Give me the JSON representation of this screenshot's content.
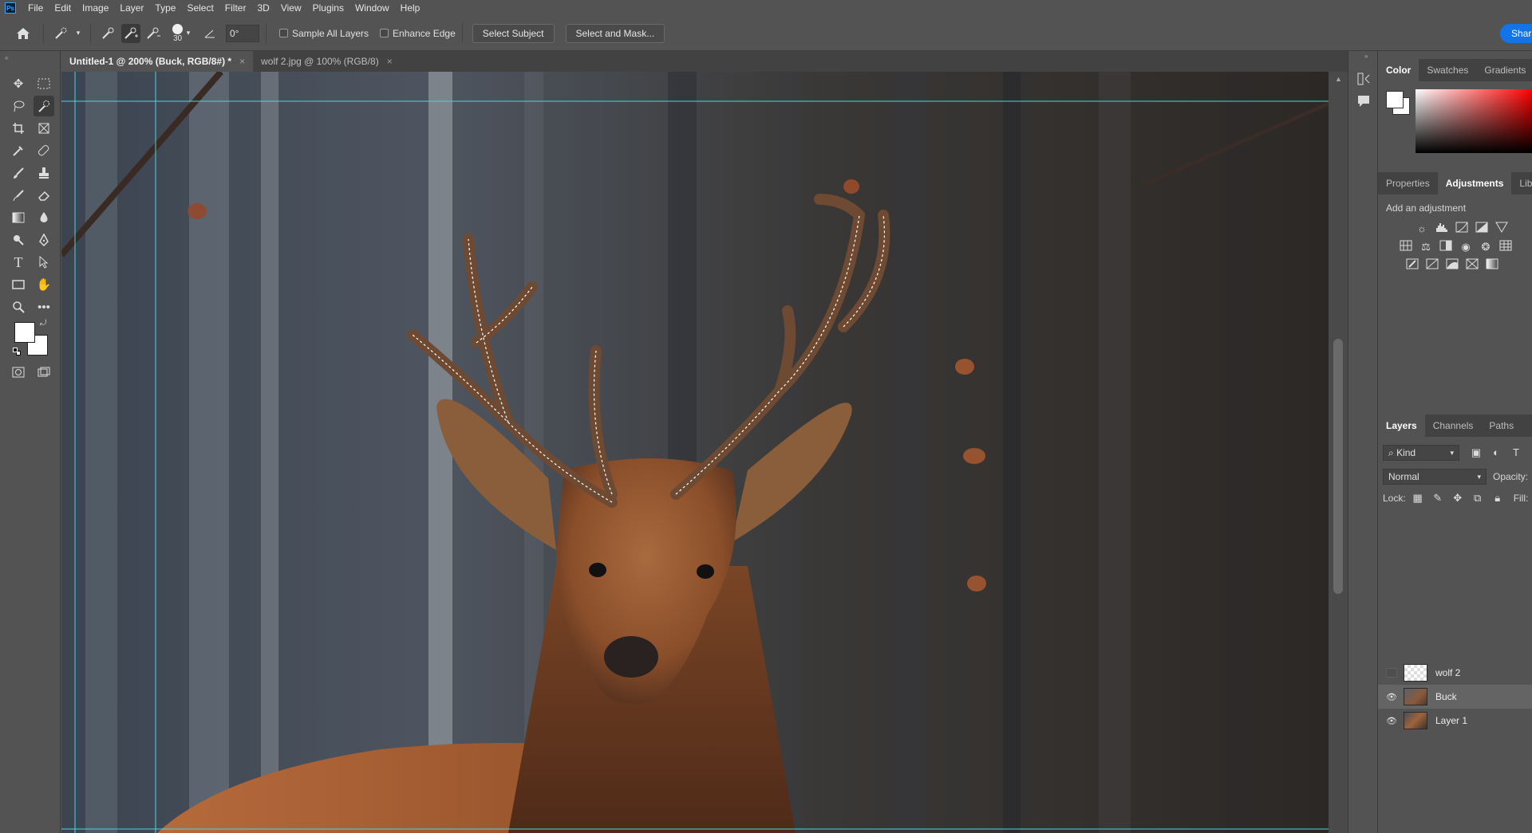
{
  "app": {
    "logo": "Ps",
    "menu": [
      "File",
      "Edit",
      "Image",
      "Layer",
      "Type",
      "Select",
      "Filter",
      "3D",
      "View",
      "Plugins",
      "Window",
      "Help"
    ]
  },
  "options": {
    "brush_size": "30",
    "angle": "0°",
    "sample_all_layers": "Sample All Layers",
    "enhance_edge": "Enhance Edge",
    "select_subject": "Select Subject",
    "select_and_mask": "Select and Mask...",
    "share": "Shar"
  },
  "tabs": [
    {
      "label": "Untitled-1 @ 200% (Buck, RGB/8#) *",
      "close": "×"
    },
    {
      "label": "wolf 2.jpg @ 100% (RGB/8)",
      "close": "×"
    }
  ],
  "panels": {
    "color_tabs": [
      "Color",
      "Swatches",
      "Gradients"
    ],
    "adjust_tabs": [
      "Properties",
      "Adjustments",
      "Libr"
    ],
    "add_adjustment": "Add an adjustment",
    "layer_tabs": [
      "Layers",
      "Channels",
      "Paths"
    ],
    "kind": "Kind",
    "blend_mode": "Normal",
    "opacity_label": "Opacity:",
    "lock_label": "Lock:",
    "fill_label": "Fill:"
  },
  "layers": [
    {
      "name": "wolf 2",
      "visible": false
    },
    {
      "name": "Buck",
      "visible": true
    },
    {
      "name": "Layer 1",
      "visible": true
    }
  ],
  "colors": {
    "accent": "#1473e6",
    "guide": "#49d6e3",
    "foreground": "#ffffff",
    "background": "#ffffff"
  }
}
